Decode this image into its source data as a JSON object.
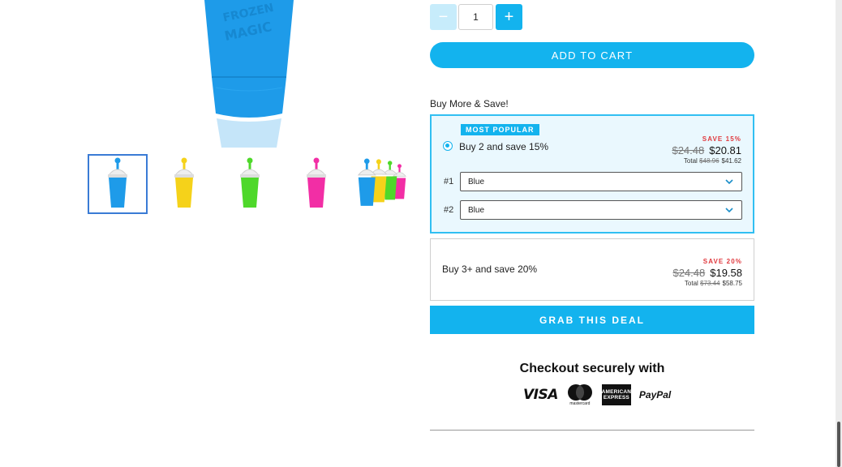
{
  "product": {
    "hero_image": "product-cup-blue",
    "hero_color": "#1e9be9",
    "thumbnails": [
      {
        "name": "thumb-blue",
        "color": "#1e9be9",
        "active": true
      },
      {
        "name": "thumb-yellow",
        "color": "#f5d21a",
        "active": false
      },
      {
        "name": "thumb-green",
        "color": "#4ed82a",
        "active": false
      },
      {
        "name": "thumb-pink",
        "color": "#f22ea5",
        "active": false
      },
      {
        "name": "thumb-multi",
        "colors": [
          "#1e9be9",
          "#f5d21a",
          "#4ed82a",
          "#f22ea5"
        ],
        "active": false
      }
    ]
  },
  "quantity": {
    "minus_label": "−",
    "value": "1",
    "plus_label": "+"
  },
  "cart": {
    "add_label": "ADD TO CART"
  },
  "bundle": {
    "heading": "Buy More & Save!",
    "offers": [
      {
        "badge": "MOST POPULAR",
        "label": "Buy 2 and save 15%",
        "save": "SAVE 15%",
        "old_price": "$24.48",
        "price": "$20.81",
        "total_label": "Total",
        "total_old": "$48.96",
        "total": "$41.62",
        "selected": true,
        "variants": [
          {
            "label": "#1",
            "value": "Blue"
          },
          {
            "label": "#2",
            "value": "Blue"
          }
        ]
      },
      {
        "label": "Buy 3+ and save 20%",
        "save": "SAVE 20%",
        "old_price": "$24.48",
        "price": "$19.58",
        "total_label": "Total",
        "total_old": "$73.44",
        "total": "$58.75",
        "selected": false
      }
    ],
    "cta": "GRAB THIS DEAL"
  },
  "checkout": {
    "title": "Checkout securely with",
    "visa": "VISA",
    "mastercard": "mastercard",
    "amex_line1": "AMERICAN",
    "amex_line2": "EXPRESS",
    "paypal": "PayPal"
  },
  "colors": {
    "accent": "#13b3ee",
    "accent_light": "#c7ecfb",
    "save_red": "#e0393e",
    "selected_bg": "#eaf8fe"
  }
}
